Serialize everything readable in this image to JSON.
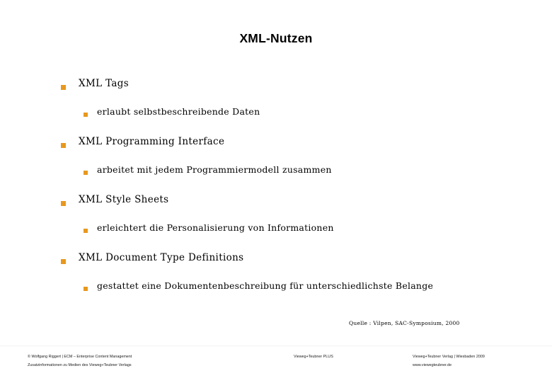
{
  "slide": {
    "title": "XML-Nutzen",
    "bullets": [
      {
        "level1": "XML Tags",
        "level2": "erlaubt selbstbeschreibende Daten"
      },
      {
        "level1": "XML Programming Interface",
        "level2": "arbeitet mit jedem Programmiermodell zusammen"
      },
      {
        "level1": "XML Style Sheets",
        "level2": "erleichtert die Personalisierung von Informationen"
      },
      {
        "level1": "XML Document Type Definitions",
        "level2": "gestattet eine Dokumentenbeschreibung für unterschiedlichste Belange"
      }
    ],
    "source_note": "Quelle : Vilpen, SAC-Symposium, 2000"
  },
  "footer": {
    "left": {
      "line1": "© Wolfgang Riggert | ECM – Enterprise Content Management",
      "line2": "Zusatzinformationen zu Medien des Vieweg+Teubner Verlags"
    },
    "center": {
      "line1": "Vieweg+Teubner PLUS"
    },
    "right": {
      "line1": "Vieweg+Teubner Verlag | Wiesbaden 2009",
      "line2": "www.viewegteubner.de"
    }
  },
  "colors": {
    "bullet_marker": "#E8981E",
    "text": "#000000",
    "background": "#FFFFFF"
  }
}
